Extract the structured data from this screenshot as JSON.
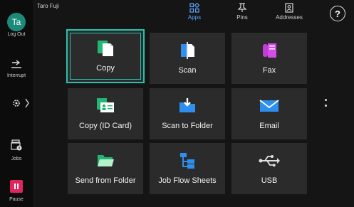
{
  "user": {
    "initials": "Ta",
    "name": "Taro Fuji"
  },
  "rail": {
    "logout_label": "Log Out",
    "interrupt_label": "Interrupt",
    "jobs_label": "Jobs",
    "pause_label": "Pause"
  },
  "tabs": [
    {
      "label": "Apps",
      "icon": "apps-grid-icon",
      "active": true
    },
    {
      "label": "Pins",
      "icon": "pin-icon",
      "active": false
    },
    {
      "label": "Addresses",
      "icon": "address-book-icon",
      "active": false
    }
  ],
  "help_label": "?",
  "apps": [
    {
      "label": "Copy",
      "icon": "copy-icon",
      "selected": true
    },
    {
      "label": "Scan",
      "icon": "scan-icon"
    },
    {
      "label": "Fax",
      "icon": "fax-icon"
    },
    {
      "label": "Copy (ID Card)",
      "icon": "id-card-copy-icon"
    },
    {
      "label": "Scan to Folder",
      "icon": "scan-to-folder-icon"
    },
    {
      "label": "Email",
      "icon": "email-icon"
    },
    {
      "label": "Send from Folder",
      "icon": "send-from-folder-icon"
    },
    {
      "label": "Job Flow Sheets",
      "icon": "job-flow-icon"
    },
    {
      "label": "USB",
      "icon": "usb-icon"
    }
  ],
  "colors": {
    "accent": "#27c1ad",
    "active_tab": "#5aa6ff",
    "tile": "#2b2b2b"
  }
}
